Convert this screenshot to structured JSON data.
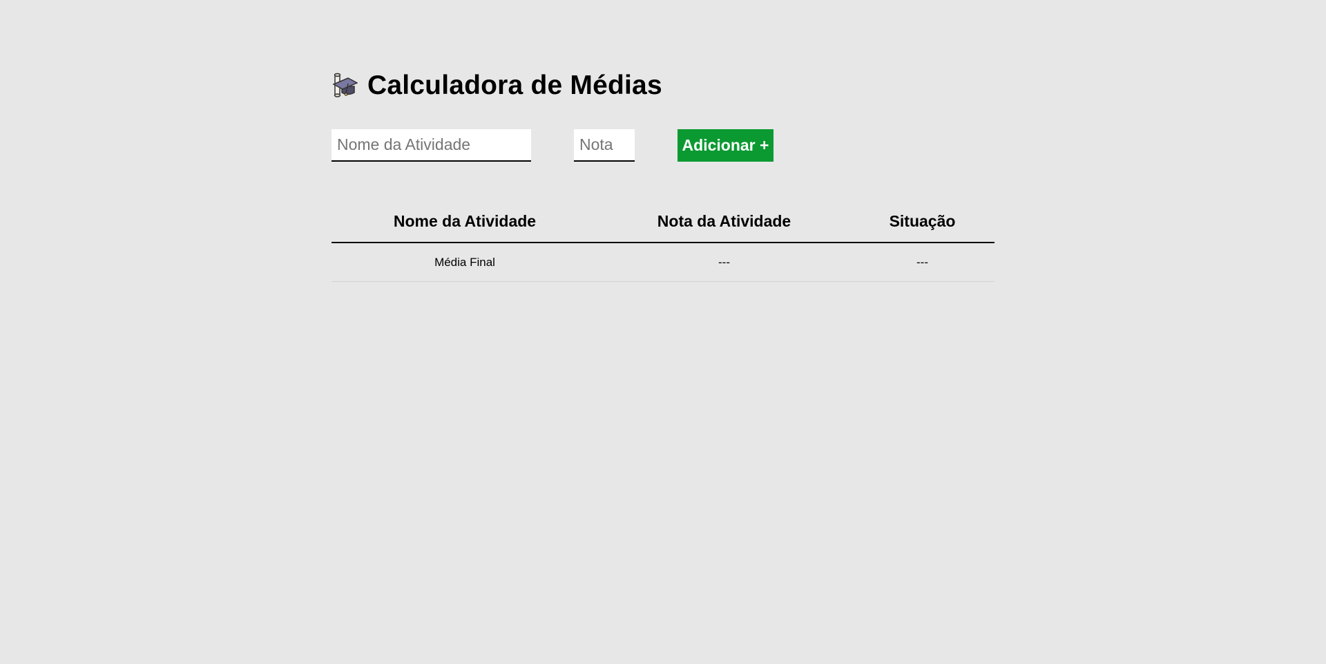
{
  "header": {
    "title": "Calculadora de Médias",
    "icon": "graduation-cap-diploma-icon"
  },
  "form": {
    "activity_name_placeholder": "Nome da Atividade",
    "grade_placeholder": "Nota",
    "add_button_label": "Adicionar +",
    "add_button_color": "#0a9a31"
  },
  "table": {
    "headers": [
      "Nome da Atividade",
      "Nota da Atividade",
      "Situação"
    ],
    "footer_row": [
      "Média Final",
      "---",
      "---"
    ]
  },
  "colors": {
    "background": "#e7e7e7",
    "accent": "#0a9a31"
  }
}
